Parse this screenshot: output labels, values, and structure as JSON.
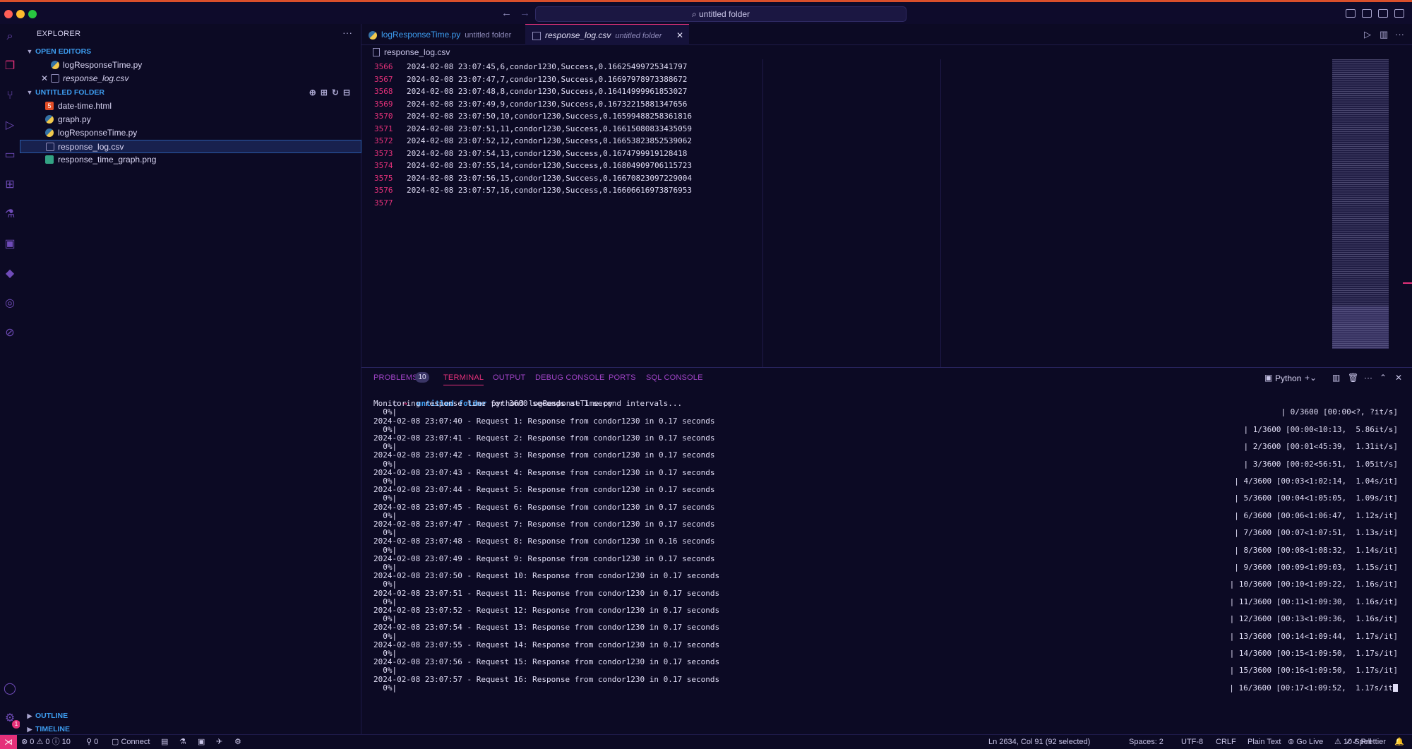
{
  "titlebar": {
    "search_text": "untitled folder",
    "back_icon": "arrow-left-icon",
    "forward_icon": "arrow-right-icon"
  },
  "sidebar": {
    "title": "EXPLORER",
    "open_editors_label": "OPEN EDITORS",
    "open_editors": [
      {
        "name": "logResponseTime.py",
        "icon": "python-icon"
      },
      {
        "name": "response_log.csv",
        "icon": "csv-icon"
      }
    ],
    "folder_label": "UNTITLED FOLDER",
    "files": [
      {
        "name": "date-time.html",
        "icon": "html-icon"
      },
      {
        "name": "graph.py",
        "icon": "python-icon"
      },
      {
        "name": "logResponseTime.py",
        "icon": "python-icon"
      },
      {
        "name": "response_log.csv",
        "icon": "csv-icon"
      },
      {
        "name": "response_time_graph.png",
        "icon": "image-icon"
      }
    ],
    "outline_label": "OUTLINE",
    "timeline_label": "TIMELINE"
  },
  "tabs": [
    {
      "name": "logResponseTime.py",
      "desc": "untitled folder"
    },
    {
      "name": "response_log.csv",
      "desc": "untitled folder"
    }
  ],
  "breadcrumb": "response_log.csv",
  "editor": {
    "lines": [
      {
        "num": "3566",
        "text": "2024-02-08 23:07:45,6,condor1230,Success,0.16625499725341797"
      },
      {
        "num": "3567",
        "text": "2024-02-08 23:07:47,7,condor1230,Success,0.16697978973388672"
      },
      {
        "num": "3568",
        "text": "2024-02-08 23:07:48,8,condor1230,Success,0.16414999961853027"
      },
      {
        "num": "3569",
        "text": "2024-02-08 23:07:49,9,condor1230,Success,0.16732215881347656"
      },
      {
        "num": "3570",
        "text": "2024-02-08 23:07:50,10,condor1230,Success,0.16599488258361816"
      },
      {
        "num": "3571",
        "text": "2024-02-08 23:07:51,11,condor1230,Success,0.16615080833435059"
      },
      {
        "num": "3572",
        "text": "2024-02-08 23:07:52,12,condor1230,Success,0.16653823852539062"
      },
      {
        "num": "3573",
        "text": "2024-02-08 23:07:54,13,condor1230,Success,0.1674799919128418"
      },
      {
        "num": "3574",
        "text": "2024-02-08 23:07:55,14,condor1230,Success,0.16804909706115723"
      },
      {
        "num": "3575",
        "text": "2024-02-08 23:07:56,15,condor1230,Success,0.16670823097229004"
      },
      {
        "num": "3576",
        "text": "2024-02-08 23:07:57,16,condor1230,Success,0.16606616973876953"
      },
      {
        "num": "3577",
        "text": ""
      }
    ]
  },
  "panel": {
    "tabs": [
      "PROBLEMS",
      "TERMINAL",
      "OUTPUT",
      "DEBUG CONSOLE",
      "PORTS",
      "SQL CONSOLE"
    ],
    "problems_count": "10",
    "terminal_profile": "Python",
    "prompt_arrow": "→",
    "prompt_dir": "untitled folder",
    "prompt_cmd": "python3 logResponseTime.py",
    "monitoring_line": "Monitoring response time for 3600 seconds at 1 second intervals...",
    "progress_prefix": "  0%|",
    "first_progress": "| 0/3600 [00:00<?, ?it/s]",
    "requests": [
      {
        "line": "2024-02-08 23:07:40 - Request 1: Response from condor1230 in 0.17 seconds",
        "progress": "| 1/3600 [00:00<10:13,  5.86it/s]"
      },
      {
        "line": "2024-02-08 23:07:41 - Request 2: Response from condor1230 in 0.17 seconds",
        "progress": "| 2/3600 [00:01<45:39,  1.31it/s]"
      },
      {
        "line": "2024-02-08 23:07:42 - Request 3: Response from condor1230 in 0.17 seconds",
        "progress": "| 3/3600 [00:02<56:51,  1.05it/s]"
      },
      {
        "line": "2024-02-08 23:07:43 - Request 4: Response from condor1230 in 0.17 seconds",
        "progress": "| 4/3600 [00:03<1:02:14,  1.04s/it]"
      },
      {
        "line": "2024-02-08 23:07:44 - Request 5: Response from condor1230 in 0.17 seconds",
        "progress": "| 5/3600 [00:04<1:05:05,  1.09s/it]"
      },
      {
        "line": "2024-02-08 23:07:45 - Request 6: Response from condor1230 in 0.17 seconds",
        "progress": "| 6/3600 [00:06<1:06:47,  1.12s/it]"
      },
      {
        "line": "2024-02-08 23:07:47 - Request 7: Response from condor1230 in 0.17 seconds",
        "progress": "| 7/3600 [00:07<1:07:51,  1.13s/it]"
      },
      {
        "line": "2024-02-08 23:07:48 - Request 8: Response from condor1230 in 0.16 seconds",
        "progress": "| 8/3600 [00:08<1:08:32,  1.14s/it]"
      },
      {
        "line": "2024-02-08 23:07:49 - Request 9: Response from condor1230 in 0.17 seconds",
        "progress": "| 9/3600 [00:09<1:09:03,  1.15s/it]"
      },
      {
        "line": "2024-02-08 23:07:50 - Request 10: Response from condor1230 in 0.17 seconds",
        "progress": "| 10/3600 [00:10<1:09:22,  1.16s/it]"
      },
      {
        "line": "2024-02-08 23:07:51 - Request 11: Response from condor1230 in 0.17 seconds",
        "progress": "| 11/3600 [00:11<1:09:30,  1.16s/it]"
      },
      {
        "line": "2024-02-08 23:07:52 - Request 12: Response from condor1230 in 0.17 seconds",
        "progress": "| 12/3600 [00:13<1:09:36,  1.16s/it]"
      },
      {
        "line": "2024-02-08 23:07:54 - Request 13: Response from condor1230 in 0.17 seconds",
        "progress": "| 13/3600 [00:14<1:09:44,  1.17s/it]"
      },
      {
        "line": "2024-02-08 23:07:55 - Request 14: Response from condor1230 in 0.17 seconds",
        "progress": "| 14/3600 [00:15<1:09:50,  1.17s/it]"
      },
      {
        "line": "2024-02-08 23:07:56 - Request 15: Response from condor1230 in 0.17 seconds",
        "progress": "| 15/3600 [00:16<1:09:50,  1.17s/it]"
      },
      {
        "line": "2024-02-08 23:07:57 - Request 16: Response from condor1230 in 0.17 seconds",
        "progress": "| 16/3600 [00:17<1:09:52,  1.17s/it"
      }
    ]
  },
  "statusbar": {
    "remote_icon": "remote-icon",
    "errors": "⊗ 0",
    "warnings": "⚠ 0",
    "info": "10",
    "ports": "⚲ 0",
    "connect": "Connect",
    "cursor_pos": "Ln 2634, Col 91 (92 selected)",
    "spaces": "Spaces: 2",
    "encoding": "UTF-8",
    "eol": "CRLF",
    "language": "Plain Text",
    "go_live": "Go Live",
    "spell": "10 Spell",
    "prettier": "Prettier"
  },
  "settings_badge": "1",
  "colors": {
    "accent": "#e5317a",
    "link": "#3d9df0",
    "background": "#0c0a24"
  }
}
